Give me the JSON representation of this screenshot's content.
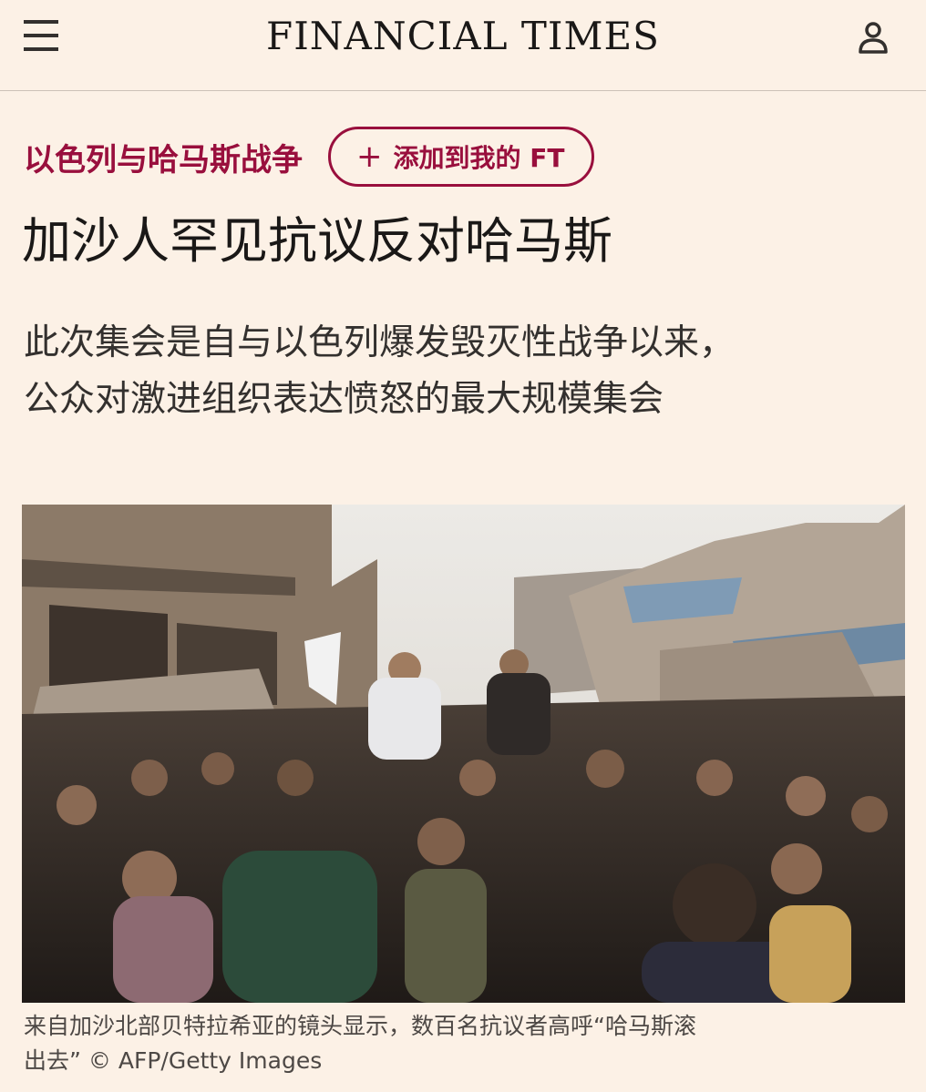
{
  "header": {
    "masthead": "FINANCIAL TIMES",
    "menu_icon": "hamburger-menu-icon",
    "account_icon": "user-account-icon"
  },
  "topic": {
    "label": "以色列与哈马斯战争",
    "follow_button": {
      "icon": "plus-icon",
      "plus": "+",
      "label": "添加到我的 FT"
    }
  },
  "article": {
    "headline": "加沙人罕见抗议反对哈马斯",
    "standfirst_line1": "此次集会是自与以色列爆发毁灭性战争以来，",
    "standfirst_line2": "公众对激进组织表达愤怒的最大规模集会",
    "caption_line1": "来自加沙北部贝特拉希亚的镜头显示，数百名抗议者高呼“哈马斯滚",
    "caption_line2": "出去” © AFP/Getty Images"
  },
  "colors": {
    "background": "#fcf1e6",
    "accent": "#990f3d",
    "text": "#33302e"
  }
}
